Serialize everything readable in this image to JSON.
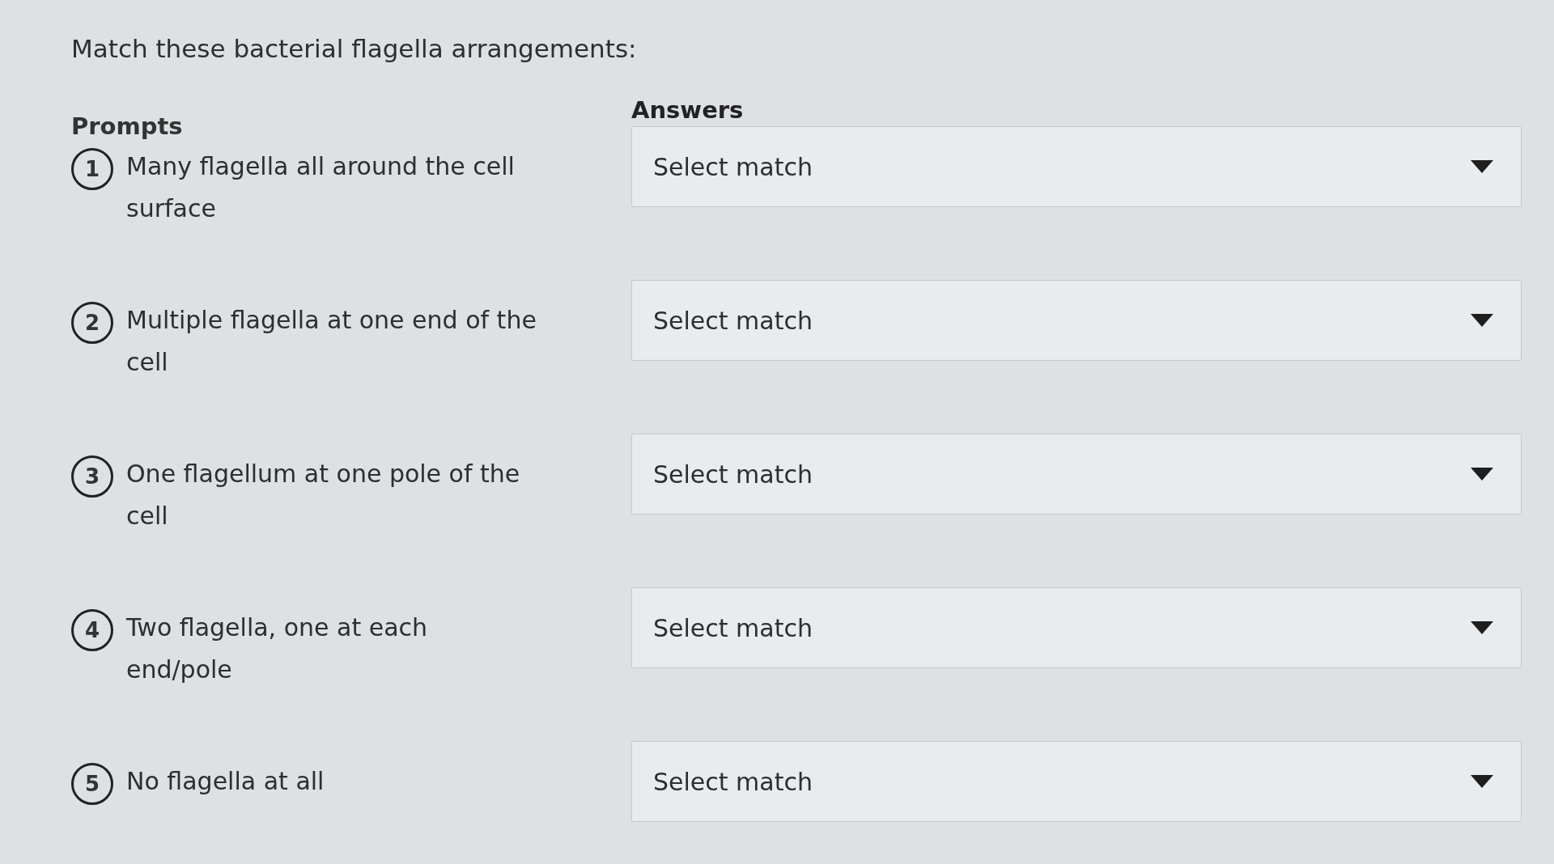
{
  "question": {
    "title": "Match these bacterial flagella arrangements:"
  },
  "columns": {
    "prompts": "Prompts",
    "answers": "Answers"
  },
  "rows": [
    {
      "number": "1",
      "prompt": "Many flagella all around the cell surface",
      "answer": {
        "placeholder": "Select match"
      }
    },
    {
      "number": "2",
      "prompt": "Multiple flagella at one end of the cell",
      "answer": {
        "placeholder": "Select match"
      }
    },
    {
      "number": "3",
      "prompt": "One flagellum at one pole of the cell",
      "answer": {
        "placeholder": "Select match"
      }
    },
    {
      "number": "4",
      "prompt": "Two flagella, one at each end/pole",
      "answer": {
        "placeholder": "Select match"
      }
    },
    {
      "number": "5",
      "prompt": "No flagella at all",
      "answer": {
        "placeholder": "Select match"
      }
    }
  ]
}
